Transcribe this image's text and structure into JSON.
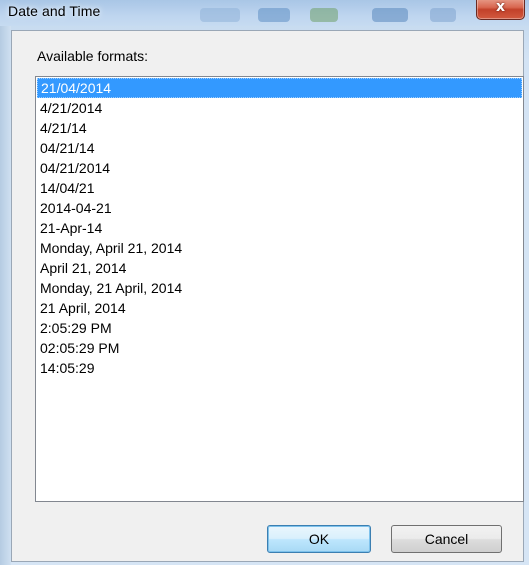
{
  "window": {
    "title": "Date and Time",
    "close_glyph": "x"
  },
  "dialog": {
    "formats_label": "Available formats:",
    "selected_index": 0,
    "formats": [
      "21/04/2014",
      "4/21/2014",
      "4/21/14",
      "04/21/14",
      "04/21/2014",
      "14/04/21",
      "2014-04-21",
      "21-Apr-14",
      "Monday, April 21, 2014",
      "April 21, 2014",
      "Monday, 21 April, 2014",
      "21 April, 2014",
      "2:05:29 PM",
      "02:05:29 PM",
      "14:05:29"
    ],
    "ok_label": "OK",
    "cancel_label": "Cancel"
  },
  "colors": {
    "selection": "#3399ff",
    "close_button": "#c2412a",
    "default_button_border": "#3c7fb1"
  },
  "icons": {
    "close": "close-icon"
  }
}
